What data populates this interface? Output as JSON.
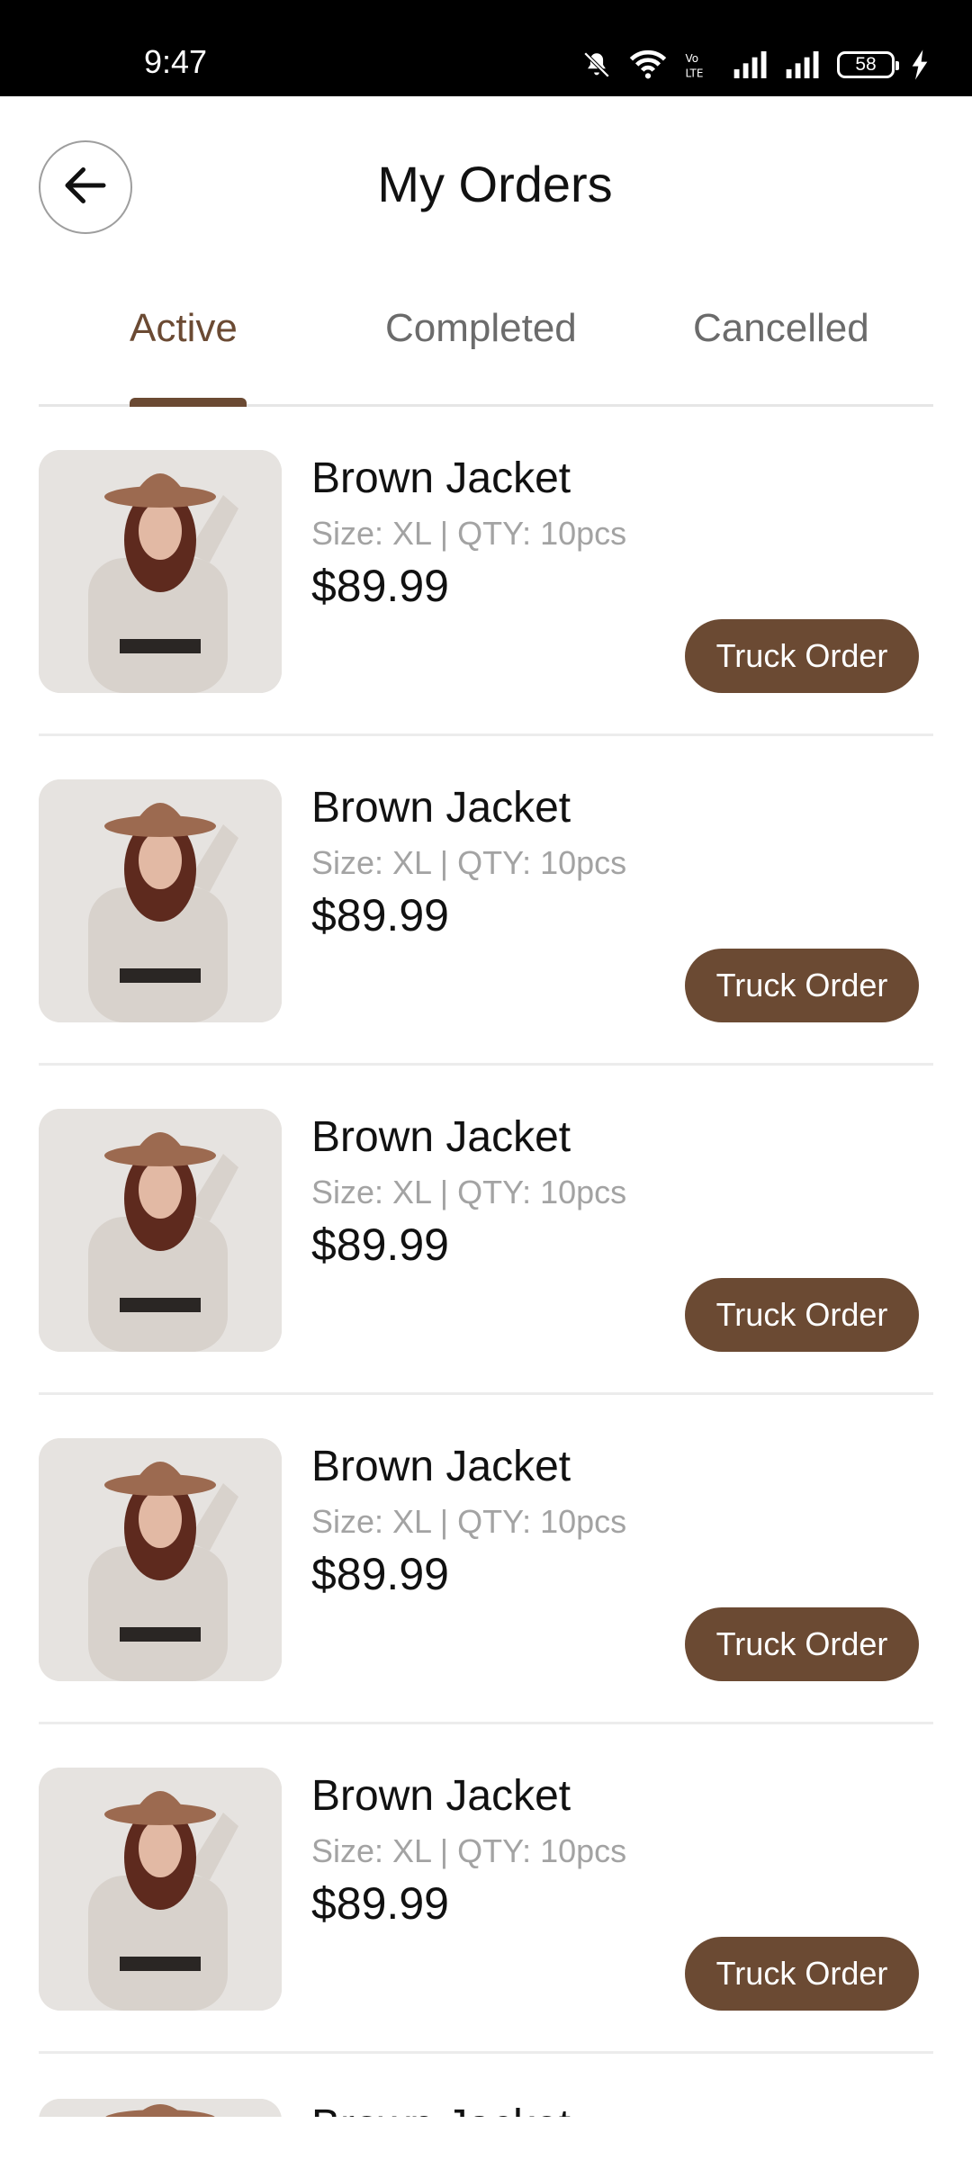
{
  "status_bar": {
    "time": "9:47",
    "battery": "58",
    "icons": [
      "mute-bell-icon",
      "wifi-icon",
      "volte-icon",
      "signal-icon",
      "signal-icon",
      "battery-icon",
      "charging-icon"
    ]
  },
  "header": {
    "title": "My Orders",
    "back_icon": "arrow-left-icon"
  },
  "tabs": [
    {
      "label": "Active",
      "active": true
    },
    {
      "label": "Completed",
      "active": false
    },
    {
      "label": "Cancelled",
      "active": false
    }
  ],
  "colors": {
    "accent": "#6b4a33",
    "muted_text": "#a3a3a3",
    "tab_inactive": "#6b6b6b"
  },
  "orders": [
    {
      "name": "Brown Jacket",
      "meta": "Size: XL | QTY: 10pcs",
      "price": "$89.99",
      "button": "Truck Order"
    },
    {
      "name": "Brown Jacket",
      "meta": "Size: XL | QTY: 10pcs",
      "price": "$89.99",
      "button": "Truck Order"
    },
    {
      "name": "Brown Jacket",
      "meta": "Size: XL | QTY: 10pcs",
      "price": "$89.99",
      "button": "Truck Order"
    },
    {
      "name": "Brown Jacket",
      "meta": "Size: XL | QTY: 10pcs",
      "price": "$89.99",
      "button": "Truck Order"
    },
    {
      "name": "Brown Jacket",
      "meta": "Size: XL | QTY: 10pcs",
      "price": "$89.99",
      "button": "Truck Order"
    }
  ],
  "partial_order": {
    "name": "Brown Jacket"
  }
}
